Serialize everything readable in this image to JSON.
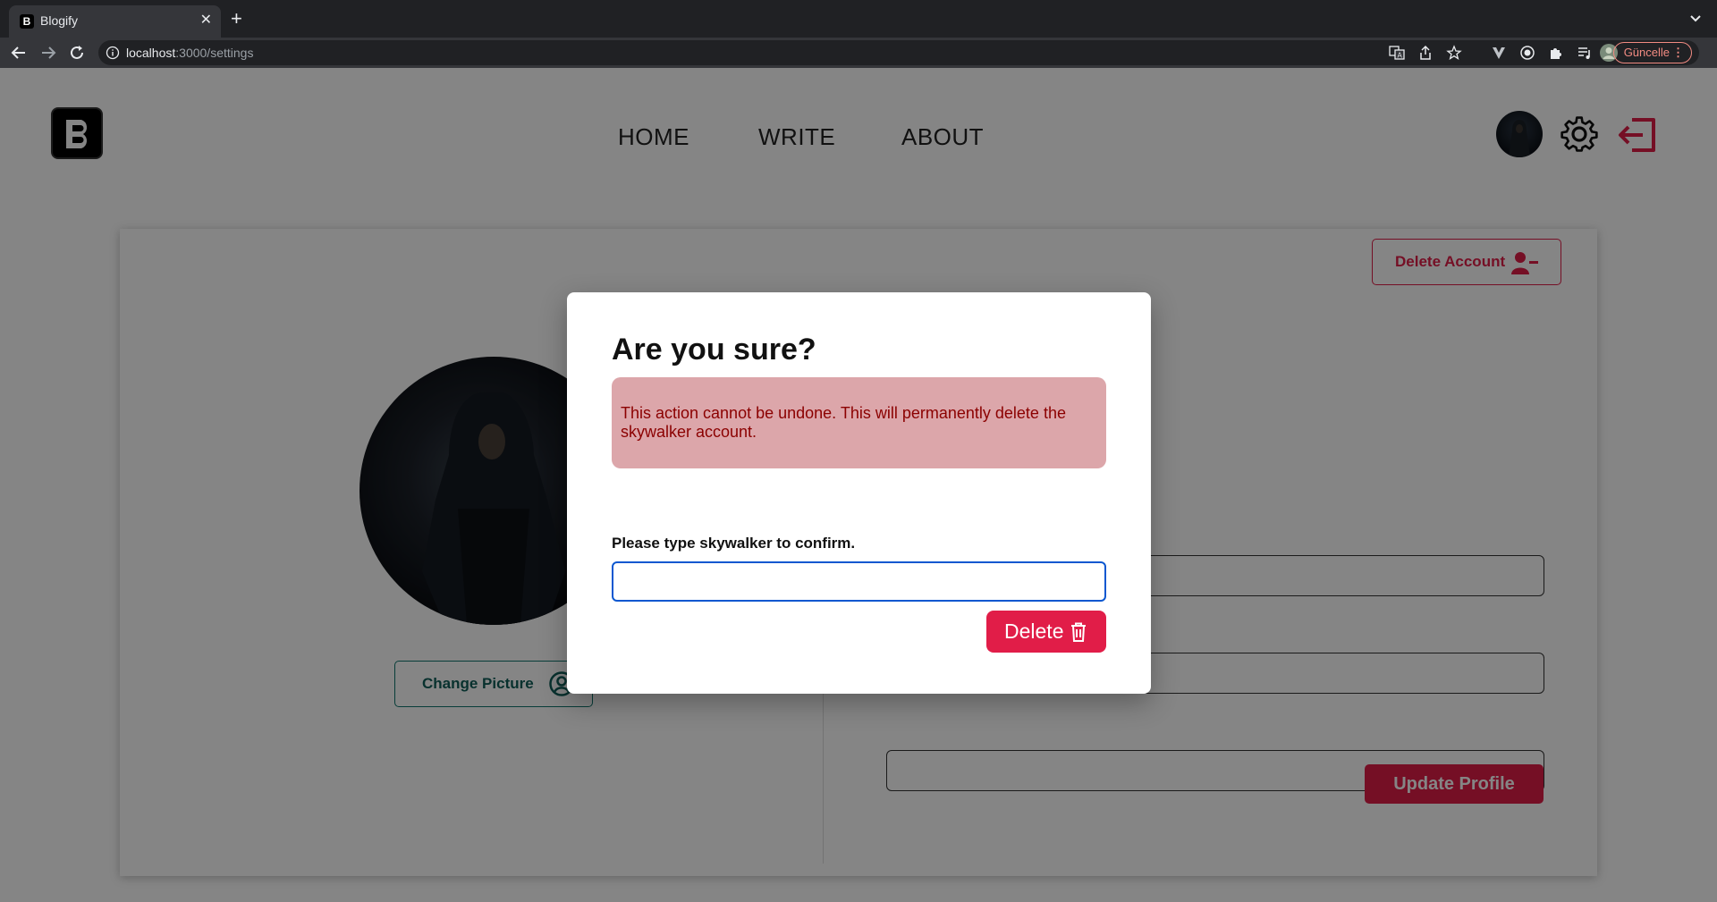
{
  "browser": {
    "tab_title": "Blogify",
    "tab_favicon": "B",
    "tab_close": "✕",
    "new_tab": "+",
    "url_host": "localhost",
    "url_path": ":3000/settings",
    "update_label": "Güncelle",
    "update_menu": "⋮"
  },
  "nav": {
    "links": [
      "HOME",
      "WRITE",
      "ABOUT"
    ]
  },
  "settings": {
    "delete_account_label": "Delete Account",
    "change_picture_label": "Change Picture",
    "update_profile_label": "Update Profile"
  },
  "modal": {
    "title": "Are you sure?",
    "warning": "This action cannot be undone. This will permanently delete the skywalker account.",
    "confirm_label": "Please type skywalker to confirm.",
    "confirm_value": "",
    "delete_label": "Delete"
  },
  "colors": {
    "accent": "#e11d48",
    "teal": "#115e59",
    "warning_bg": "#dca6aa",
    "warning_text": "#8b0000",
    "input_focus": "#0b57d0"
  },
  "icons": [
    "back-arrow-icon",
    "forward-arrow-icon",
    "reload-icon",
    "info-icon",
    "translate-icon",
    "share-icon",
    "star-icon",
    "vuetify-icon",
    "record-icon",
    "extensions-icon",
    "queue-icon",
    "profile-icon",
    "gear-icon",
    "logout-icon",
    "user-minus-icon",
    "user-circle-icon",
    "trash-icon"
  ]
}
